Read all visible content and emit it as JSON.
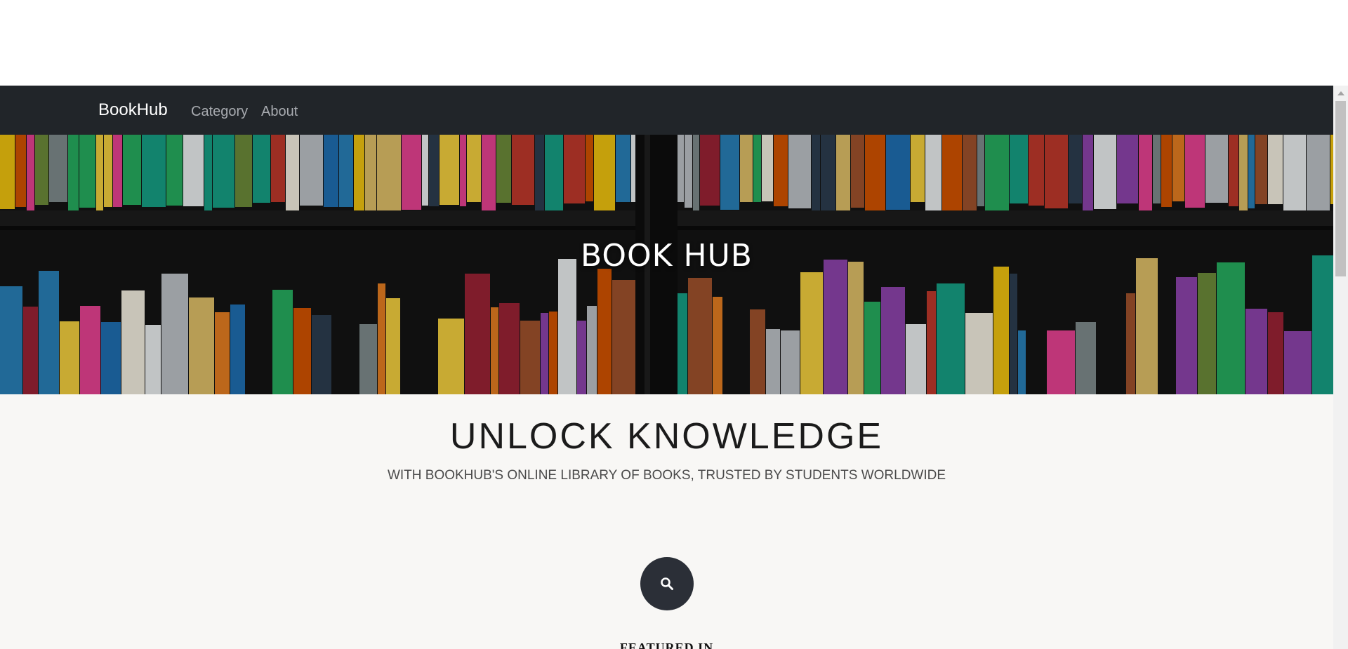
{
  "navbar": {
    "brand": "BookHub",
    "links": [
      {
        "label": "Category"
      },
      {
        "label": "About"
      }
    ]
  },
  "hero": {
    "title": "BOOK HUB"
  },
  "main": {
    "headline": "UNLOCK KNOWLEDGE",
    "subheadline": "WITH BOOKHUB'S ONLINE LIBRARY OF BOOKS, TRUSTED BY STUDENTS WORLDWIDE",
    "search_icon": "search-icon",
    "featured_heading": "FEATURED IN"
  },
  "colors": {
    "navbar_bg": "#212529",
    "page_bg": "#f8f7f5",
    "search_button_bg": "#2b2f37"
  }
}
